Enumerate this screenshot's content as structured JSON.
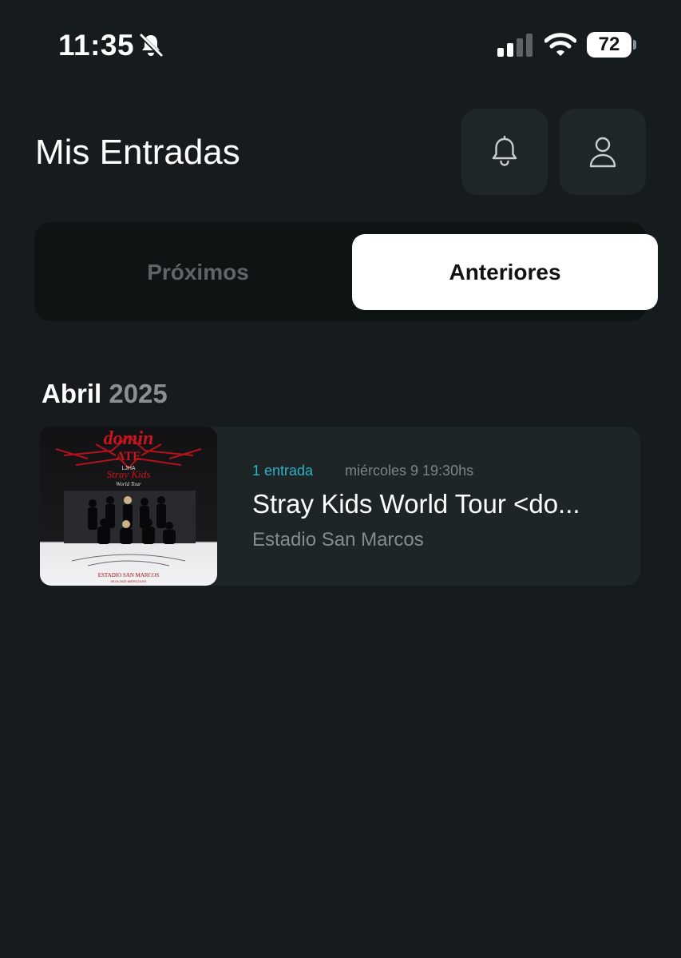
{
  "status_bar": {
    "time": "11:35",
    "silent_icon": "bell-slash-icon",
    "signal_icon": "cellular-signal-icon",
    "wifi_icon": "wifi-icon",
    "battery_percent": "72"
  },
  "header": {
    "title": "Mis Entradas",
    "notifications_icon": "bell-icon",
    "profile_icon": "user-icon"
  },
  "tabs": [
    {
      "label": "Próximos",
      "active": false
    },
    {
      "label": "Anteriores",
      "active": true
    }
  ],
  "sections": [
    {
      "month": "Abril",
      "year": "2025",
      "events": [
        {
          "ticket_count": "1 entrada",
          "date": "miércoles 9 19:30hs",
          "title": "Stray Kids World Tour <do...",
          "venue": "Estadio San Marcos",
          "poster": {
            "top_text": "domin",
            "sub_text": "ATE",
            "promoter": "LJHA",
            "artist": "Stray Kids",
            "tour": "World Tour",
            "venue_caption": "ESTADIO SAN MARCOS",
            "date_caption": "09.04.2025 MIÉRCOLES"
          }
        }
      ]
    }
  ],
  "colors": {
    "background": "#161c1e",
    "card": "#1e2527",
    "accent": "#2ab3c4",
    "active_tab": "#ffffff",
    "poster_red": "#c8141b"
  }
}
